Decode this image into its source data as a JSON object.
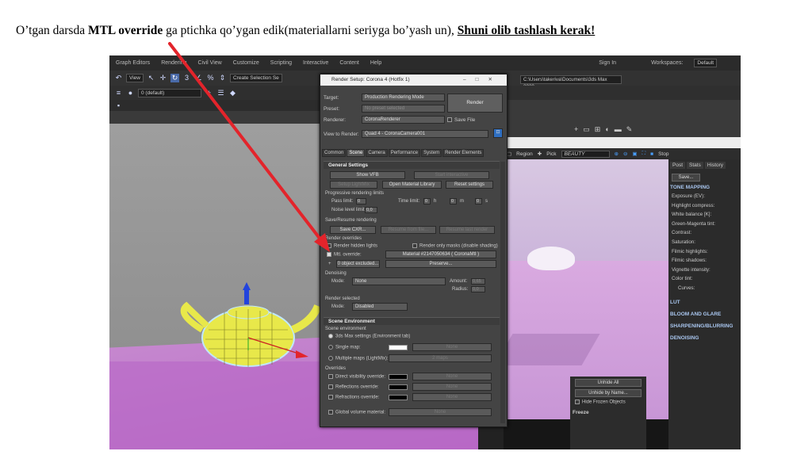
{
  "caption": {
    "before": "O’tgan darsda ",
    "bold": "MTL override",
    "middle": " ga ptichka qo’ygan edik(materiallarni seriyga bo’yash un), ",
    "underlined": "Shuni olib tashlash kerak!"
  },
  "max": {
    "menu": [
      "Graph Editors",
      "Rendering",
      "Civil View",
      "Customize",
      "Scripting",
      "Interactive",
      "Content",
      "Help"
    ],
    "user_label": "Sign In",
    "workspace_label": "Workspaces:",
    "workspace_value": "Default",
    "view_dropdown": "View",
    "selection_set": "Create Selection Se",
    "layer_label": "0 (default)",
    "path": "C:\\Users\\takeriva\\Documents\\3ds Max 2020"
  },
  "dialog": {
    "title": "Render Setup: Corona 4 (Hotfix 1)",
    "target_label": "Target:",
    "target_value": "Production Rendering Mode",
    "preset_label": "Preset:",
    "preset_value": "No preset selected",
    "renderer_label": "Renderer:",
    "renderer_value": "CoronaRenderer",
    "save_file": "Save File",
    "view_label": "View to Render:",
    "view_value": "Quad 4 - CoronaCamera001",
    "render_button": "Render",
    "tabs": [
      "Common",
      "Scene",
      "Camera",
      "Performance",
      "System",
      "Render Elements"
    ],
    "general": {
      "header": "General Settings",
      "show_vfb": "Show VFB",
      "start_interactive": "Start interactive",
      "setup_lightmix": "Setup LightMix",
      "open_material_library": "Open Material Library",
      "reset_settings": "Reset settings",
      "progressive_label": "Progressive rendering limits",
      "pass_limit_label": "Pass limit:",
      "pass_limit_value": "0",
      "time_limit_label": "Time limit:",
      "time_h": "0",
      "time_m": "0",
      "time_s": "0",
      "h": "h",
      "m": "m",
      "s": "s",
      "noise_label": "Noise level limit:",
      "noise_value": "0,0",
      "save_resume_label": "Save/Resume rendering",
      "save_cxr": "Save CXR...",
      "resume_from_file": "Resume from file...",
      "resume_last": "Resume last render",
      "overrides_label": "Render overrides",
      "render_hidden": "Render hidden lights",
      "render_only_masks": "Render only masks (disable shading)",
      "mtl_override_label": "Mtl. override:",
      "mtl_override_value": "Material #2147050634 ( CoronaMtl )",
      "plus": "+",
      "object_excluded": "0 object excluded...",
      "preserve": "Preserve...",
      "denoising_label": "Denoising",
      "mode_label": "Mode:",
      "mode_value": "None",
      "amount_label": "Amount:",
      "amount_value": "0,65",
      "radius_label": "Radius:",
      "radius_value": "0,0",
      "render_selected_label": "Render selected",
      "rs_mode_label": "Mode:",
      "rs_mode_value": "Disabled"
    },
    "scene_env": {
      "header": "Scene Environment",
      "env_label": "Scene environment",
      "max_settings": "3ds Max settings (Environment tab)",
      "single_map": "Single map:",
      "single_none": "None",
      "multiple_maps": "Multiple maps (LightMix):",
      "multiple_value": "2 maps",
      "overrides_label": "Overrides",
      "direct_vis": "Direct visibility override:",
      "direct_none": "None",
      "reflections": "Reflections override:",
      "refl_none": "None",
      "refractions": "Refractions override:",
      "refr_none": "None",
      "global_volume": "Global volume material:",
      "volume_none": "None"
    }
  },
  "vfb": {
    "region": "Region",
    "pick": "Pick",
    "channel": "BEAUTY",
    "stop": "Stop",
    "tabs": [
      "Post",
      "Stats",
      "History"
    ],
    "save": "Save...",
    "tone_mapping": "TONE MAPPING",
    "rows": [
      "Exposure (EV):",
      "Highlight compress:",
      "White balance [K]:",
      "Green-Magenta tint:",
      "Contrast:",
      "Saturation:",
      "Filmic highlights:",
      "Filmic shadows:",
      "Vignette intensity:",
      "Color tint:",
      "Curves:"
    ],
    "sections": [
      "LUT",
      "BLOOM AND GLARE",
      "SHARPENING/BLURRING",
      "DENOISING"
    ]
  },
  "outliner": {
    "unhide_all": "Unhide All",
    "unhide_by_name": "Unhide by Name...",
    "hide_frozen": "Hide Frozen Objects",
    "freeze": "Freeze"
  },
  "colors": {
    "arrow": "#e3242b",
    "floor": "#b96ac6",
    "teapot": "#e8e84a"
  }
}
